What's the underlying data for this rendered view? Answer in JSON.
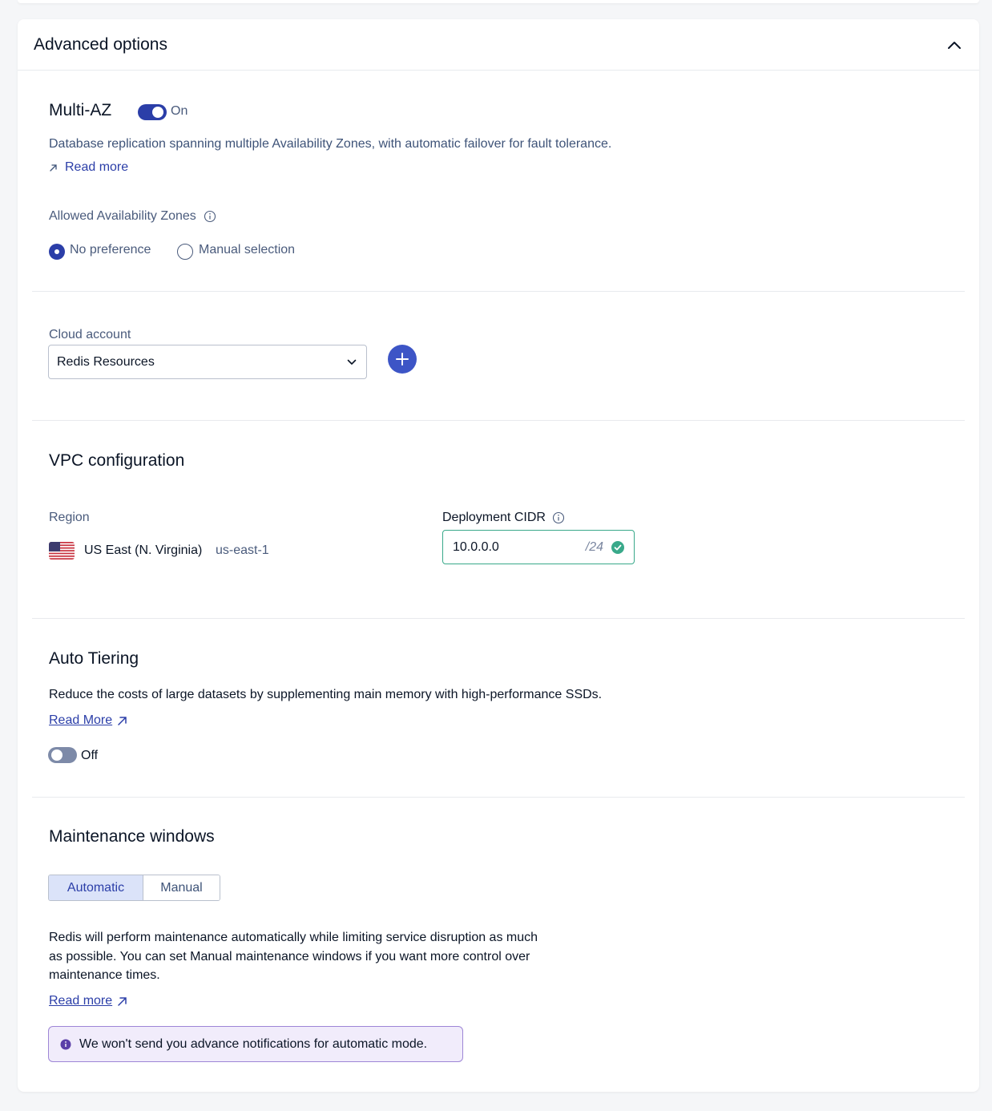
{
  "panel": {
    "title": "Advanced options"
  },
  "multi_az": {
    "title": "Multi-AZ",
    "toggle_label": "On",
    "enabled": true,
    "description": "Database replication spanning multiple Availability Zones, with automatic failover for fault tolerance.",
    "read_more": "Read more",
    "zones_label": "Allowed Availability Zones",
    "zone_options": [
      {
        "label": "No preference",
        "selected": true
      },
      {
        "label": "Manual selection",
        "selected": false
      }
    ]
  },
  "cloud_account": {
    "label": "Cloud account",
    "selected": "Redis Resources"
  },
  "vpc": {
    "title": "VPC configuration",
    "region_label": "Region",
    "region_name": "US East (N. Virginia)",
    "region_code": "us-east-1",
    "cidr_label": "Deployment CIDR",
    "cidr_value": "10.0.0.0",
    "cidr_suffix": "/24"
  },
  "auto_tiering": {
    "title": "Auto Tiering",
    "description": "Reduce the costs of large datasets by supplementing main memory with high-performance SSDs.",
    "read_more": "Read More",
    "toggle_label": "Off",
    "enabled": false
  },
  "maintenance": {
    "title": "Maintenance windows",
    "modes": [
      "Automatic",
      "Manual"
    ],
    "active_mode": "Automatic",
    "description_line1": "Redis will perform maintenance automatically while limiting service disruption as much",
    "description_line2": "as possible. You can set Manual maintenance windows if you want more control over",
    "description_line3": "maintenance times.",
    "read_more": "Read more",
    "notice": "We won't send you advance notifications for automatic mode."
  },
  "colors": {
    "primary": "#2b3ea8",
    "success": "#39a98a",
    "notice_bg": "#f1ecfb",
    "notice_border": "#9e86d6"
  }
}
